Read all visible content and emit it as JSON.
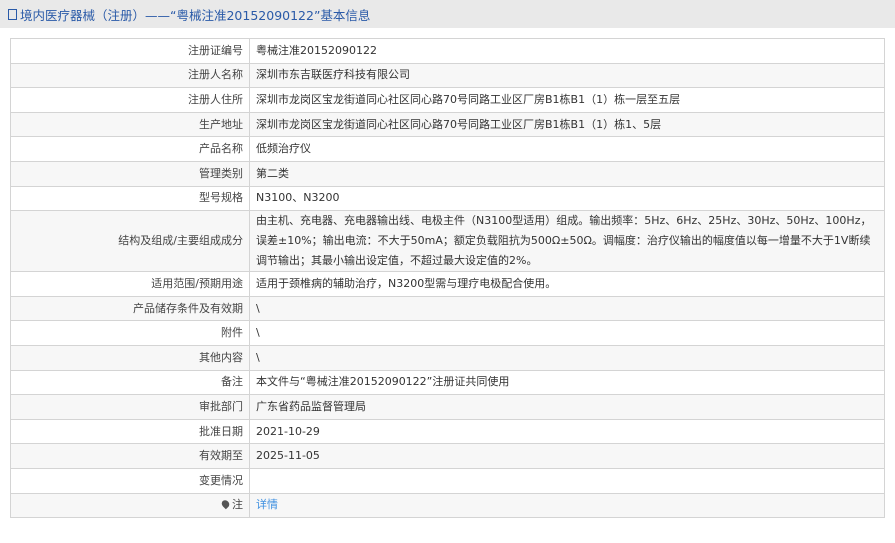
{
  "header": {
    "title": "境内医疗器械（注册）——“粤械注准20152090122”基本信息"
  },
  "rows": [
    {
      "label": "注册证编号",
      "value": "粤械注准20152090122"
    },
    {
      "label": "注册人名称",
      "value": "深圳市东吉联医疗科技有限公司"
    },
    {
      "label": "注册人住所",
      "value": "深圳市龙岗区宝龙街道同心社区同心路70号同路工业区厂房B1栋B1（1）栋一层至五层"
    },
    {
      "label": "生产地址",
      "value": "深圳市龙岗区宝龙街道同心社区同心路70号同路工业区厂房B1栋B1（1）栋1、5层"
    },
    {
      "label": "产品名称",
      "value": "低频治疗仪"
    },
    {
      "label": "管理类别",
      "value": "第二类"
    },
    {
      "label": "型号规格",
      "value": "N3100、N3200"
    },
    {
      "label": "结构及组成/主要组成成分",
      "value": "由主机、充电器、充电器输出线、电极主件（N3100型适用）组成。输出频率：5Hz、6Hz、25Hz、30Hz、50Hz、100Hz，误差±10%；输出电流：不大于50mA；额定负载阻抗为500Ω±50Ω。调幅度：治疗仪输出的幅度值以每一增量不大于1V断续调节输出；其最小输出设定值，不超过最大设定值的2%。"
    },
    {
      "label": "适用范围/预期用途",
      "value": "适用于颈椎病的辅助治疗，N3200型需与理疗电极配合使用。"
    },
    {
      "label": "产品储存条件及有效期",
      "value": "\\"
    },
    {
      "label": "附件",
      "value": "\\"
    },
    {
      "label": "其他内容",
      "value": "\\"
    },
    {
      "label": "备注",
      "value": "本文件与“粤械注准20152090122”注册证共同使用"
    },
    {
      "label": "审批部门",
      "value": "广东省药品监督管理局"
    },
    {
      "label": "批准日期",
      "value": "2021-10-29"
    },
    {
      "label": "有效期至",
      "value": "2025-11-05"
    },
    {
      "label": "变更情况",
      "value": ""
    }
  ],
  "note": {
    "label": "注",
    "link": "详情"
  }
}
